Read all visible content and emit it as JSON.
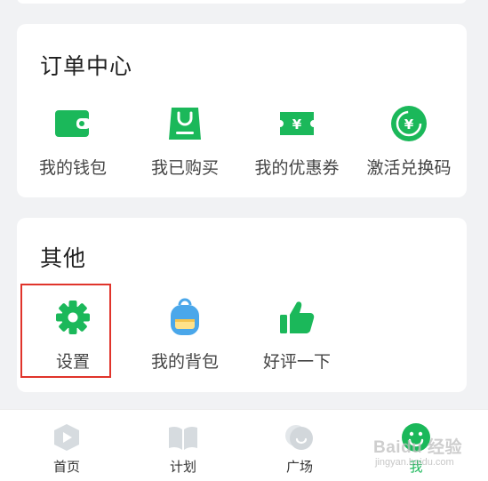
{
  "orders": {
    "title": "订单中心",
    "items": [
      {
        "label": "我的钱包",
        "icon": "wallet-icon"
      },
      {
        "label": "我已购买",
        "icon": "shopping-bag-icon"
      },
      {
        "label": "我的优惠券",
        "icon": "coupon-icon"
      },
      {
        "label": "激活兑换码",
        "icon": "redeem-code-icon"
      }
    ]
  },
  "other": {
    "title": "其他",
    "items": [
      {
        "label": "设置",
        "icon": "gear-icon"
      },
      {
        "label": "我的背包",
        "icon": "backpack-icon"
      },
      {
        "label": "好评一下",
        "icon": "thumbs-up-icon"
      }
    ]
  },
  "tabbar": {
    "tabs": [
      {
        "label": "首页",
        "icon": "home-play-icon"
      },
      {
        "label": "计划",
        "icon": "book-icon"
      },
      {
        "label": "广场",
        "icon": "chat-bubble-icon"
      },
      {
        "label": "我",
        "icon": "profile-icon",
        "active": true
      }
    ]
  },
  "watermark": {
    "text": "Baidu 经验",
    "sub": "jingyan.baidu.com"
  },
  "colors": {
    "accent": "#1bb85a",
    "highlight": "#e0342b",
    "backpack": "#4aa7ea"
  }
}
